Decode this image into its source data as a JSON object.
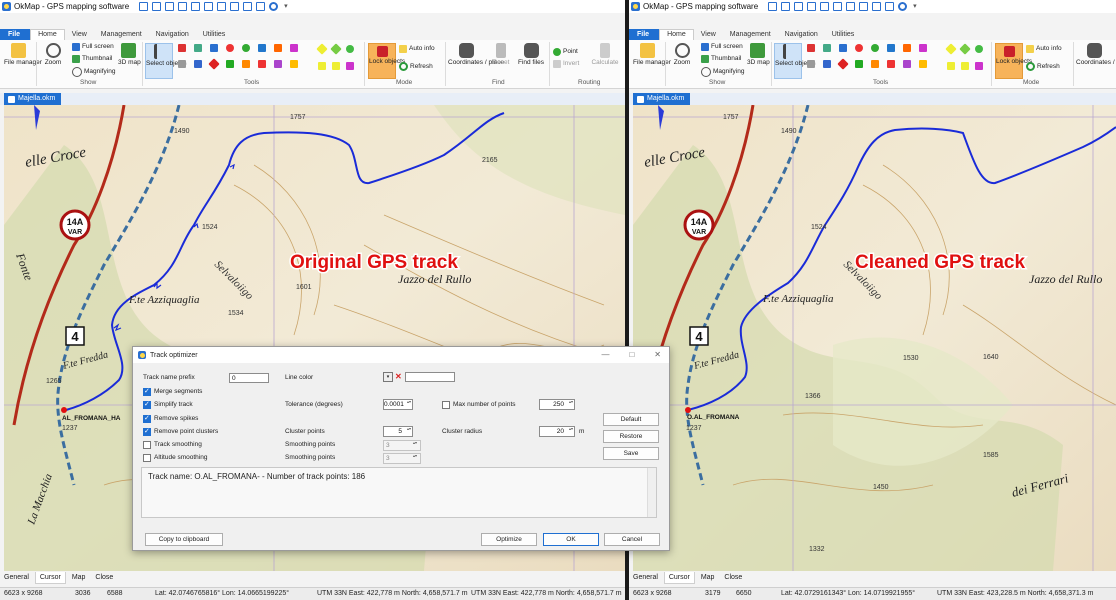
{
  "app": {
    "title": "OkMap - GPS mapping software",
    "ribbon_tabs": [
      {
        "label": "File",
        "active": false
      },
      {
        "label": "Home",
        "active": true
      },
      {
        "label": "View",
        "active": false
      },
      {
        "label": "Management",
        "active": false
      },
      {
        "label": "Navigation",
        "active": false
      },
      {
        "label": "Utilities",
        "active": false
      }
    ],
    "ribbon": {
      "file_manager": "File manager",
      "zoom": "Zoom",
      "full_screen": "Full screen",
      "thumbnail": "Thumbnail",
      "magnifying": "Magnifying",
      "map_3d": "3D map",
      "show_group": "Show",
      "select_objects": "Select objects",
      "tools_group": "Tools",
      "lock_objects": "Lock objects",
      "auto_info": "Auto info",
      "refresh": "Refresh",
      "mode_group": "Mode",
      "coordinates_place": "Coordinates / place",
      "reset": "Reset",
      "find_files": "Find files",
      "find_group": "Find",
      "point": "Point",
      "invert": "Invert",
      "calculate": "Calculate",
      "routing_group": "Routing"
    },
    "document_tab": "Majella.okm",
    "bottom_tabs": [
      "General",
      "Cursor",
      "Map",
      "Close"
    ],
    "active_bottom_tab": "Cursor"
  },
  "panes": {
    "left": {
      "overlay_label": "Original GPS track",
      "status": {
        "size": "6623 x 9268",
        "a": "3036",
        "b": "6588",
        "latlon": "Lat: 42.0746765816°  Lon: 14.0665199225°",
        "utm": "UTM 33N  East: 422,778  m  North: 4,658,571.7  m",
        "utm2": "UTM 33N  East: 422,778  m  North: 4,658,571.7  m"
      }
    },
    "right": {
      "overlay_label": "Cleaned GPS track",
      "status": {
        "size": "6623 x 9268",
        "a": "3179",
        "b": "6650",
        "latlon": "Lat: 42.0729161343°  Lon: 14.0719921955°",
        "utm": "UTM 33N  East: 423,228.5  m  North: 4,658,371.3  m"
      }
    }
  },
  "map_labels": {
    "elle_croce": "elle Croce",
    "fonte": "Fonte",
    "road_badge_top": "14A",
    "road_badge_bottom": "VAR",
    "route_number": "4",
    "fte_azziquaglia": "F.te Azziquaglia",
    "fte_fredda": "F.te Fredda",
    "jazzo_del_rullo": "Jazzo del Rullo",
    "selvaloiigo": "Selvaloiigo",
    "al_fromana": "AL_FROMANA_HA",
    "o_al_fromana": "O.AL_FROMANA",
    "dei_ferrari": "dei Ferrari",
    "la_macchia": "La Macchia",
    "elev": {
      "e1757": "1757",
      "e2165": "2165",
      "e1490": "1490",
      "e1524": "1524",
      "e1601": "1601",
      "e1534": "1534",
      "e1265": "1265",
      "e1237": "1237",
      "e1530": "1530",
      "e1640": "1640",
      "e1366": "1366",
      "e1585": "1585",
      "e1450": "1450",
      "e1332": "1332"
    }
  },
  "dialog": {
    "title": "Track optimizer",
    "track_name_prefix_label": "Track name prefix",
    "track_name_prefix_value": "0",
    "line_color_label": "Line color",
    "merge_segments": {
      "label": "Merge segments",
      "checked": true
    },
    "simplify_track": {
      "label": "Simplify track",
      "checked": true
    },
    "remove_spikes": {
      "label": "Remove spikes",
      "checked": true
    },
    "remove_point_clusters": {
      "label": "Remove point clusters",
      "checked": true
    },
    "track_smoothing": {
      "label": "Track smoothing",
      "checked": false
    },
    "altitude_smoothing": {
      "label": "Altitude smoothing",
      "checked": false
    },
    "tolerance_label": "Tolerance (degrees)",
    "tolerance_value": "0.0001",
    "max_points_label": "Max number of points",
    "max_points_checked": false,
    "max_points_value": "250",
    "cluster_points_label": "Cluster points",
    "cluster_points_value": "5",
    "cluster_radius_label": "Cluster radius",
    "cluster_radius_value": "20",
    "cluster_radius_unit": "m",
    "smoothing_points_label_1": "Smoothing points",
    "smoothing_points_value_1": "3",
    "smoothing_points_label_2": "Smoothing points",
    "smoothing_points_value_2": "3",
    "info_text": "Track name: O.AL_FROMANA- - Number of track points: 186",
    "buttons": {
      "default": "Default",
      "restore": "Restore",
      "save": "Save",
      "copy_clipboard": "Copy to clipboard",
      "optimize": "Optimize",
      "ok": "OK",
      "cancel": "Cancel"
    }
  },
  "colors": {
    "track_blue": "#1a2bd8",
    "overlay_red": "#e01010",
    "ribbon_blue": "#1f6fd1",
    "lock_orange": "#f7b35a"
  }
}
